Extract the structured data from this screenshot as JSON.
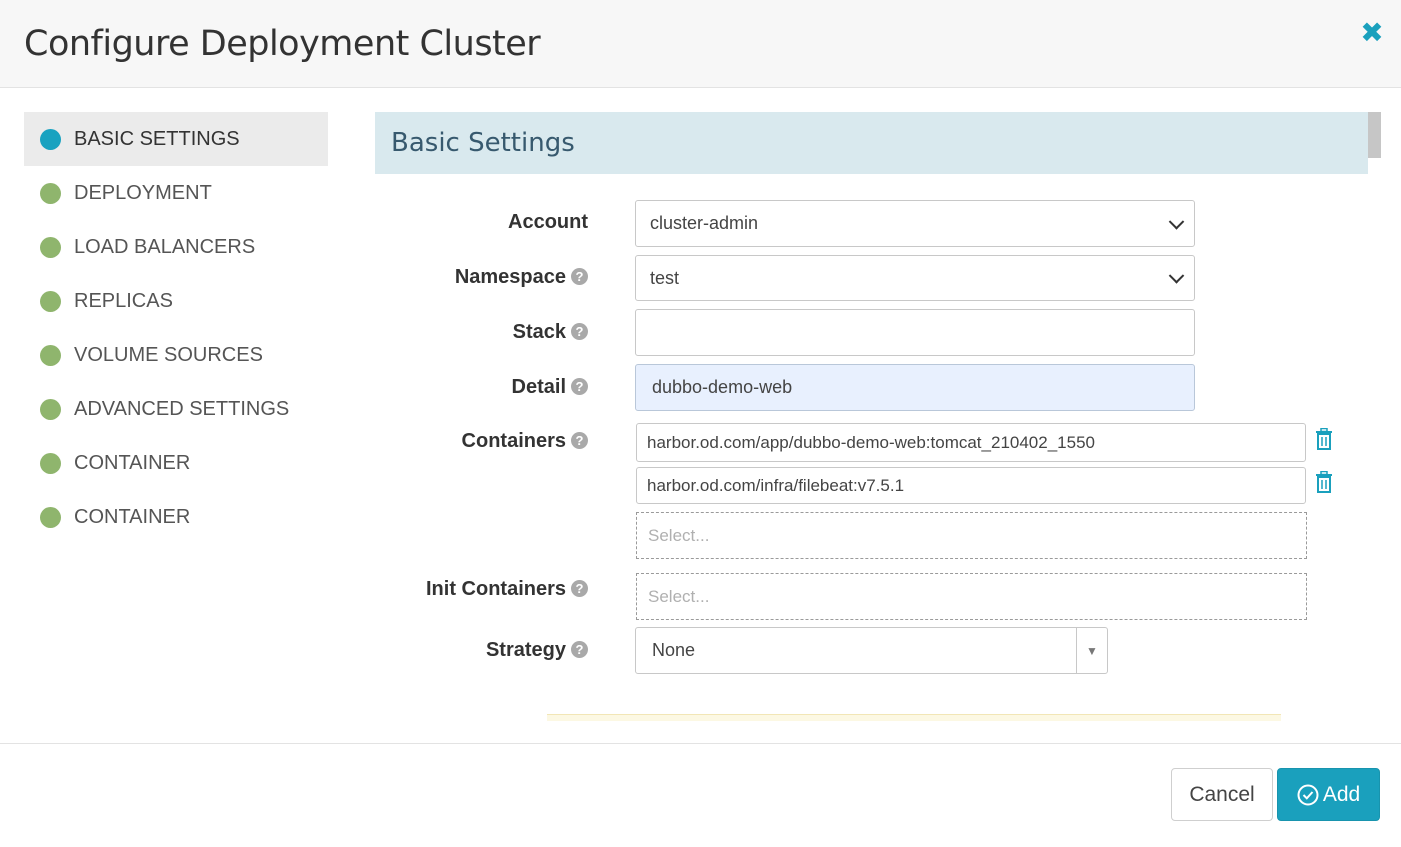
{
  "dialog": {
    "title": "Configure Deployment Cluster"
  },
  "nav": {
    "items": [
      {
        "label": "BASIC SETTINGS"
      },
      {
        "label": "DEPLOYMENT"
      },
      {
        "label": "LOAD BALANCERS"
      },
      {
        "label": "REPLICAS"
      },
      {
        "label": "VOLUME SOURCES"
      },
      {
        "label": "ADVANCED SETTINGS"
      },
      {
        "label": "CONTAINER"
      },
      {
        "label": "CONTAINER"
      }
    ]
  },
  "section": {
    "title": "Basic Settings"
  },
  "form": {
    "account": {
      "label": "Account",
      "value": "cluster-admin"
    },
    "namespace": {
      "label": "Namespace",
      "value": "test"
    },
    "stack": {
      "label": "Stack",
      "value": ""
    },
    "detail": {
      "label": "Detail",
      "value": "dubbo-demo-web"
    },
    "containers": {
      "label": "Containers",
      "items": [
        "harbor.od.com/app/dubbo-demo-web:tomcat_210402_1550",
        "harbor.od.com/infra/filebeat:v7.5.1"
      ],
      "placeholder": "Select..."
    },
    "init_containers": {
      "label": "Init Containers",
      "placeholder": "Select..."
    },
    "strategy": {
      "label": "Strategy",
      "value": "None"
    }
  },
  "footer": {
    "cancel_label": "Cancel",
    "add_label": "Add"
  },
  "colors": {
    "accent": "#1aa0bd",
    "nav_dot": "#8fb56d",
    "section_bg": "#d9e9ee"
  }
}
